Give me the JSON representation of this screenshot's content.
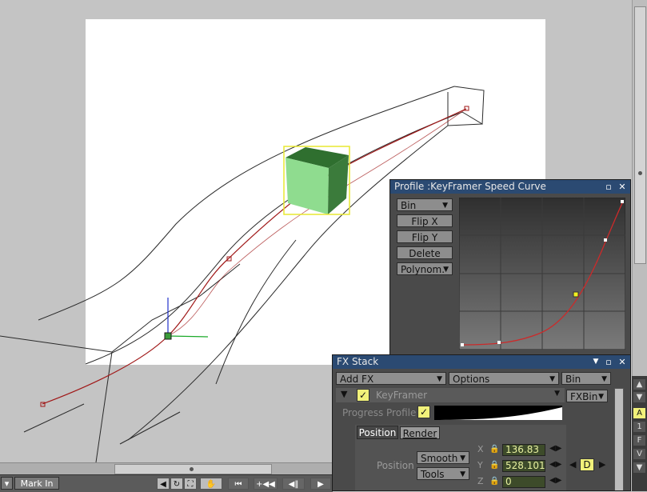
{
  "profile_panel": {
    "title": "Profile :KeyFramer Speed Curve",
    "buttons": {
      "bin": "Bin",
      "flip_x": "Flip X",
      "flip_y": "Flip Y",
      "delete": "Delete",
      "polynom": "Polynom."
    }
  },
  "fx_panel": {
    "title": "FX Stack",
    "add_fx": "Add FX",
    "options": "Options",
    "bin": "Bin",
    "effect_name": "KeyFramer",
    "fxbin": "FXBin",
    "progress_profile_label": "Progress Profile",
    "tabs": {
      "position": "Position",
      "render": "Render"
    },
    "position_label": "Position",
    "interp": "Smooth",
    "tools": "Tools",
    "axes": {
      "x": "X",
      "y": "Y",
      "z": "Z"
    },
    "values": {
      "x": "136.83",
      "y": "528.101",
      "z": "0"
    },
    "key_button": "D"
  },
  "bottom_bar": {
    "mark_in": "Mark In"
  },
  "side_strip": {
    "labels": [
      "A",
      "1",
      "F",
      "V"
    ]
  },
  "colors": {
    "title_bar": "#2b4a72",
    "canvas": "#ffffff",
    "path": "#a01818",
    "field_bg": "#3d4b2a",
    "field_text": "#e8f0a0",
    "highlight": "#f1f17a"
  }
}
